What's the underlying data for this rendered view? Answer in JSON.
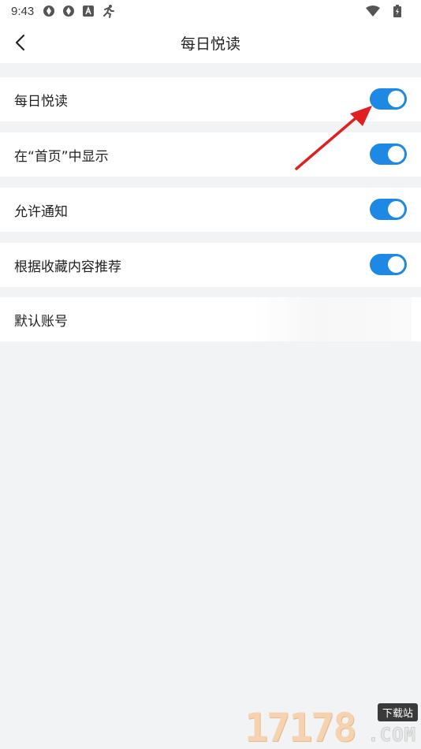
{
  "status_bar": {
    "time": "9:43",
    "icons": [
      "aperture-icon",
      "aperture-icon",
      "font-a-icon",
      "running-person-icon"
    ],
    "right_icons": [
      "wifi-icon",
      "battery-charging-icon"
    ]
  },
  "header": {
    "title": "每日悦读",
    "back_icon": "chevron-left-icon"
  },
  "settings": [
    {
      "label": "每日悦读",
      "control": "toggle",
      "on": true
    },
    {
      "label": "在“首页”中显示",
      "control": "toggle",
      "on": true
    },
    {
      "label": "允许通知",
      "control": "toggle",
      "on": true
    },
    {
      "label": "根据收藏内容推荐",
      "control": "toggle",
      "on": true
    },
    {
      "label": "默认账号",
      "control": "value",
      "value": ""
    }
  ],
  "colors": {
    "accent": "#1e88e5",
    "background": "#f2f3f5",
    "row_background": "#ffffff",
    "annotation_arrow": "#e02020"
  },
  "watermark": {
    "number": "17178",
    "badge": "下载站",
    "suffix": ".COM"
  }
}
